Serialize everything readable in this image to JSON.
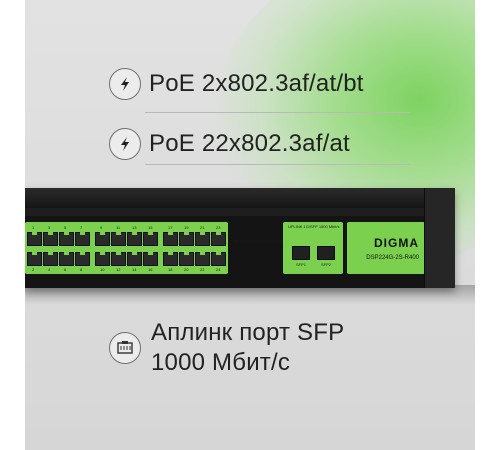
{
  "features": [
    {
      "icon": "lightning-icon",
      "text": "PoE 2x802.3af/at/bt"
    },
    {
      "icon": "lightning-icon",
      "text": "PoE 22x802.3af/at"
    },
    {
      "icon": "ethernet-port-icon",
      "line1": "Аплинк порт SFP",
      "line2": "1000 Мбит/с"
    }
  ],
  "device": {
    "brand": "DIGMA",
    "model": "DSP224G-2S-R400",
    "port_caption": "PoE 802.3af/at 10/100/1000 Mbit/s",
    "sfp_caption": "UPLINK 1G/SFP 1000 Mbit/s",
    "sfp_labels": [
      "SFP1",
      "SFP2"
    ],
    "top_numbers": [
      "1",
      "3",
      "5",
      "7",
      "9",
      "11",
      "13",
      "15",
      "17",
      "19",
      "21",
      "23"
    ],
    "bottom_numbers": [
      "2",
      "4",
      "6",
      "8",
      "10",
      "12",
      "14",
      "16",
      "18",
      "20",
      "22",
      "24"
    ]
  },
  "colors": {
    "accent_green": "#7bd14e",
    "device_body": "#1e1e1e",
    "background": "#dcdcdc"
  }
}
